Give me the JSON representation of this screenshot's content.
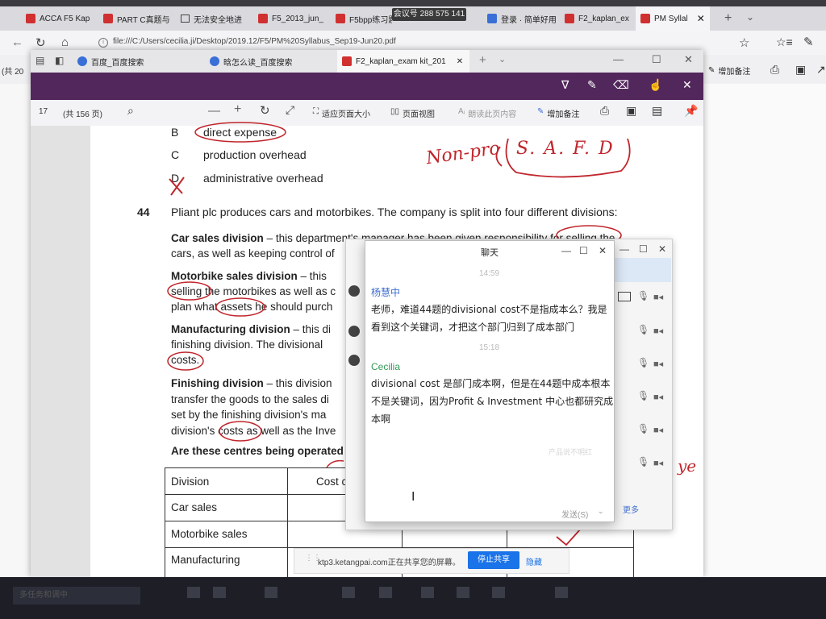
{
  "browser": {
    "tabs": [
      {
        "label": "ACCA F5 Kap"
      },
      {
        "label": "PART C真题与"
      },
      {
        "label": "无法安全地进"
      },
      {
        "label": "F5_2013_jun_"
      },
      {
        "label": "F5bpp练习题"
      },
      {
        "label": "会议号 288 575 141"
      },
      {
        "label": "登录 · 简单好用"
      },
      {
        "label": "F2_kaplan_ex"
      },
      {
        "label": "PM Syllal"
      }
    ],
    "address": "file:///C:/Users/cecilia.ji/Desktop/2019.12/F5/PM%20Syllabus_Sep19-Jun20.pdf",
    "left_edge": "(共 20",
    "right_toolbar": {
      "add_note": "增加备注"
    }
  },
  "inner_browser": {
    "tabs": [
      {
        "label": "百度_百度搜索"
      },
      {
        "label": "晗怎么读_百度搜索"
      },
      {
        "label": "F2_kaplan_exam kit_201"
      }
    ]
  },
  "pdf_toolbar": {
    "page_number": "17",
    "page_total": "(共 156 页)",
    "fit_page": "适应页面大小",
    "page_view": "页面视图",
    "read_aloud": "朗读此页内容",
    "add_notes": "增加备注"
  },
  "document": {
    "options": [
      {
        "letter": "B",
        "text": "direct expense"
      },
      {
        "letter": "C",
        "text": "production overhead"
      },
      {
        "letter": "D",
        "text": "administrative overhead"
      }
    ],
    "question_number": "44",
    "question": "Pliant plc produces cars and motorbikes. The company is split into four different divisions:",
    "paragraphs": [
      {
        "bold": "Car sales division",
        "line1": " – this department's manager has been given responsibility for selling the",
        "line2": "cars, as well as keeping control of"
      },
      {
        "bold": "Motorbike sales division",
        "line1": " – this",
        "line2": "selling the motorbikes as well as c",
        "line3": "plan what assets he should purch"
      },
      {
        "bold": "Manufacturing division",
        "line1": " – this di",
        "line2": "finishing division. The divisional",
        "line3": "costs."
      },
      {
        "bold": "Finishing division",
        "line1": " – this division",
        "line2": "transfer the goods to the sales di",
        "line3": "set by the finishing division's ma",
        "line4": "division's costs as well as the Inve"
      }
    ],
    "prompt_question": "Are these centres being operated",
    "table": {
      "header": [
        "Division",
        "Cost c"
      ],
      "rows": [
        "Car sales",
        "Motorbike sales",
        "Manufacturing"
      ]
    },
    "handwriting": {
      "nonpro": "Non-pro",
      "safd": "S. A. F. D",
      "right_margin": "ye"
    }
  },
  "chat": {
    "title": "聊天",
    "times": [
      "14:59",
      "15:18"
    ],
    "messages": [
      {
        "sender": "杨慧中",
        "text_line1": "老师，难道44题的divisional cost不是指成本么？我是",
        "text_line2": "看到这个关键词，才把这个部门归到了成本部门"
      },
      {
        "sender": "Cecilia",
        "text_line1": "divisional cost 是部门成本啊，但是在44题中成本根本",
        "text_line2": "不是关键词，因为Profit & Investment 中心也都研究成",
        "text_line3": "本啊"
      }
    ],
    "hint": "产品说不明红",
    "send_button": "发送(S)",
    "more_link": "更多"
  },
  "share_bar": {
    "text": "ktp3.ketangpai.com正在共享您的屏幕。",
    "stop_button": "停止共享",
    "hide_button": "隐藏"
  },
  "taskbar": {
    "left_item": "多任务和调中"
  },
  "colors": {
    "purple_bar": "#52275c",
    "ink_red": "#c0262c",
    "chat_blue": "#3f6fd0",
    "chat_green": "#2f9a55",
    "stop_button_blue": "#1a73e8"
  }
}
